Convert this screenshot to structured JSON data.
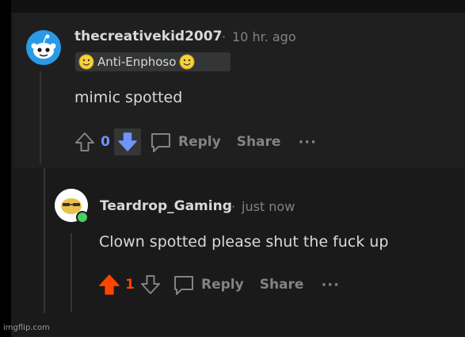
{
  "comment1": {
    "username": "thecreativekid2007",
    "separator": "·",
    "time": "10 hr. ago",
    "flair": "Anti-Enphoso",
    "body": "mimic spotted",
    "vote_count": "0",
    "reply_label": "Reply",
    "share_label": "Share",
    "more_label": "···",
    "vote_state": "downvoted"
  },
  "comment2": {
    "username": "Teardrop_Gaming",
    "separator": "·",
    "time": "just now",
    "body": "Clown spotted please shut the fuck up",
    "vote_count": "1",
    "reply_label": "Reply",
    "share_label": "Share",
    "more_label": "···",
    "vote_state": "upvoted",
    "online": true
  },
  "watermark": "imgflip.com",
  "colors": {
    "upvote": "#ff4500",
    "downvote": "#7193ff",
    "muted": "#818384",
    "text": "#d7dadc",
    "online": "#46d160"
  }
}
